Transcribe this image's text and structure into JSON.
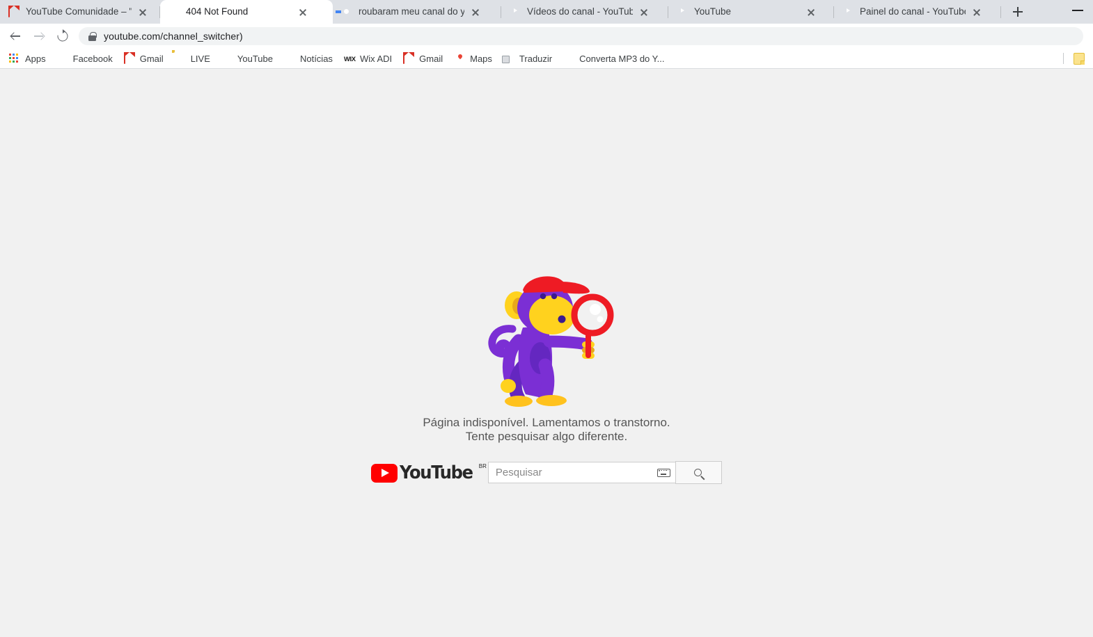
{
  "browser": {
    "tabs": [
      {
        "title": "YouTube Comunidade – \"roubara",
        "favicon": "gmail-icon",
        "active": false
      },
      {
        "title": "404 Not Found",
        "favicon": "youtube-icon",
        "active": true
      },
      {
        "title": "roubaram meu canal do youtube",
        "favicon": "google-icon",
        "active": false
      },
      {
        "title": "Vídeos do canal - YouTube Studio",
        "favicon": "youtube-icon",
        "active": false
      },
      {
        "title": "YouTube",
        "favicon": "youtube-icon",
        "active": false
      },
      {
        "title": "Painel do canal - YouTube Studio",
        "favicon": "youtube-icon",
        "active": false
      }
    ],
    "new_tab_label": "+",
    "minimize_label": "—",
    "toolbar": {
      "back_icon": "back-arrow-icon",
      "forward_icon": "forward-arrow-icon",
      "reload_icon": "reload-icon",
      "lock_icon": "lock-icon",
      "url": "youtube.com/channel_switcher)"
    },
    "bookmarks": [
      {
        "label": "Apps",
        "icon": "apps-grid-icon"
      },
      {
        "label": "Facebook",
        "icon": "facebook-icon"
      },
      {
        "label": "Gmail",
        "icon": "gmail-icon"
      },
      {
        "label": "LIVE",
        "icon": "folder-icon"
      },
      {
        "label": "YouTube",
        "icon": "youtube-icon"
      },
      {
        "label": "Notícias",
        "icon": "google-news-icon"
      },
      {
        "label": "Wix ADI",
        "icon": "wix-icon"
      },
      {
        "label": "Gmail",
        "icon": "gmail-icon"
      },
      {
        "label": "Maps",
        "icon": "google-maps-icon"
      },
      {
        "label": "Traduzir",
        "icon": "google-translate-icon"
      },
      {
        "label": "Converta MP3 do Y...",
        "icon": "mp3-download-icon"
      }
    ],
    "bookmarks_overflow_icon": "folder-overflow-icon"
  },
  "page": {
    "illustration": "monkey-with-magnifying-glass",
    "error_line1": "Página indisponível. Lamentamos o transtorno.",
    "error_line2": "Tente pesquisar algo diferente.",
    "logo": {
      "wordmark": "YouTube",
      "country_superscript": "BR",
      "play_icon": "youtube-play-icon"
    },
    "search": {
      "placeholder": "Pesquisar",
      "value": "",
      "keyboard_icon": "keyboard-icon",
      "submit_icon": "magnifier-icon"
    }
  },
  "colors": {
    "tabstrip_bg": "#dee1e6",
    "page_bg": "#f1f1f1",
    "youtube_red": "#ff0000",
    "monkey_purple": "#7b2fd4",
    "monkey_purple_dark": "#6427c0",
    "monkey_yellow": "#ffd21e",
    "monkey_yellow_dark": "#e8a81c",
    "accessory_red": "#ee1b24",
    "text_gray": "#555555"
  }
}
